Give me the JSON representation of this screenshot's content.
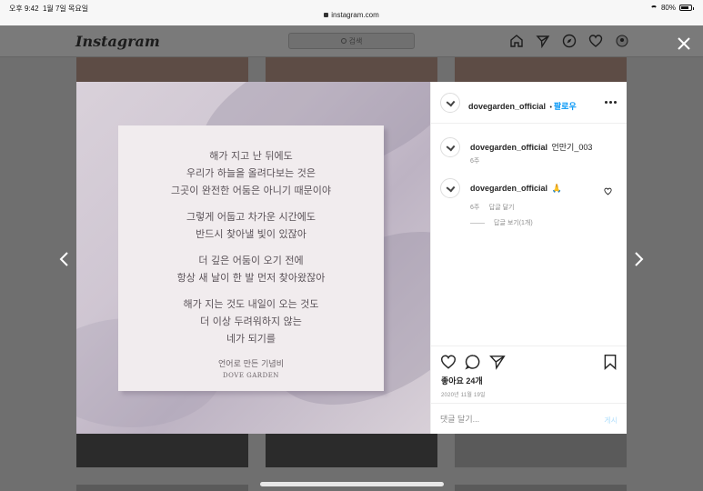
{
  "status_bar": {
    "time": "오후 9:42",
    "date": "1월 7일 목요일",
    "url": "instagram.com",
    "battery": "80%"
  },
  "header": {
    "logo": "Instagram",
    "search_placeholder": "검색"
  },
  "post": {
    "username": "dovegarden_official",
    "follow_label": "팔로우",
    "caption_text": "언만기_003",
    "caption_time": "6주",
    "image_lines": [
      [
        "해가 지고 난 뒤에도",
        "우리가 하늘을 올려다보는 것은",
        "그곳이 완전한 어둠은 아니기 때문이야"
      ],
      [
        "그렇게 어둡고 차가운 시간에도",
        "반드시 찾아낼 빛이 있잖아"
      ],
      [
        "더 깊은 어둠이 오기 전에",
        "항상 새 날이 한 발 먼저 찾아왔잖아"
      ],
      [
        "해가 지는 것도 내일이 오는 것도",
        "더 이상 두려워하지 않는",
        "네가 되기를"
      ]
    ],
    "image_footer": "언어로 만든 기념비",
    "image_brand": "DOVE GARDEN",
    "comment": {
      "username": "dovegarden_official",
      "text": "🙏",
      "time": "6주",
      "reply_label": "답글 달기",
      "view_replies": "답글 보기(1개)"
    },
    "likes": "좋아요 24개",
    "date": "2020년 11월 19일",
    "comment_placeholder": "댓글 달기...",
    "post_button": "게시"
  }
}
